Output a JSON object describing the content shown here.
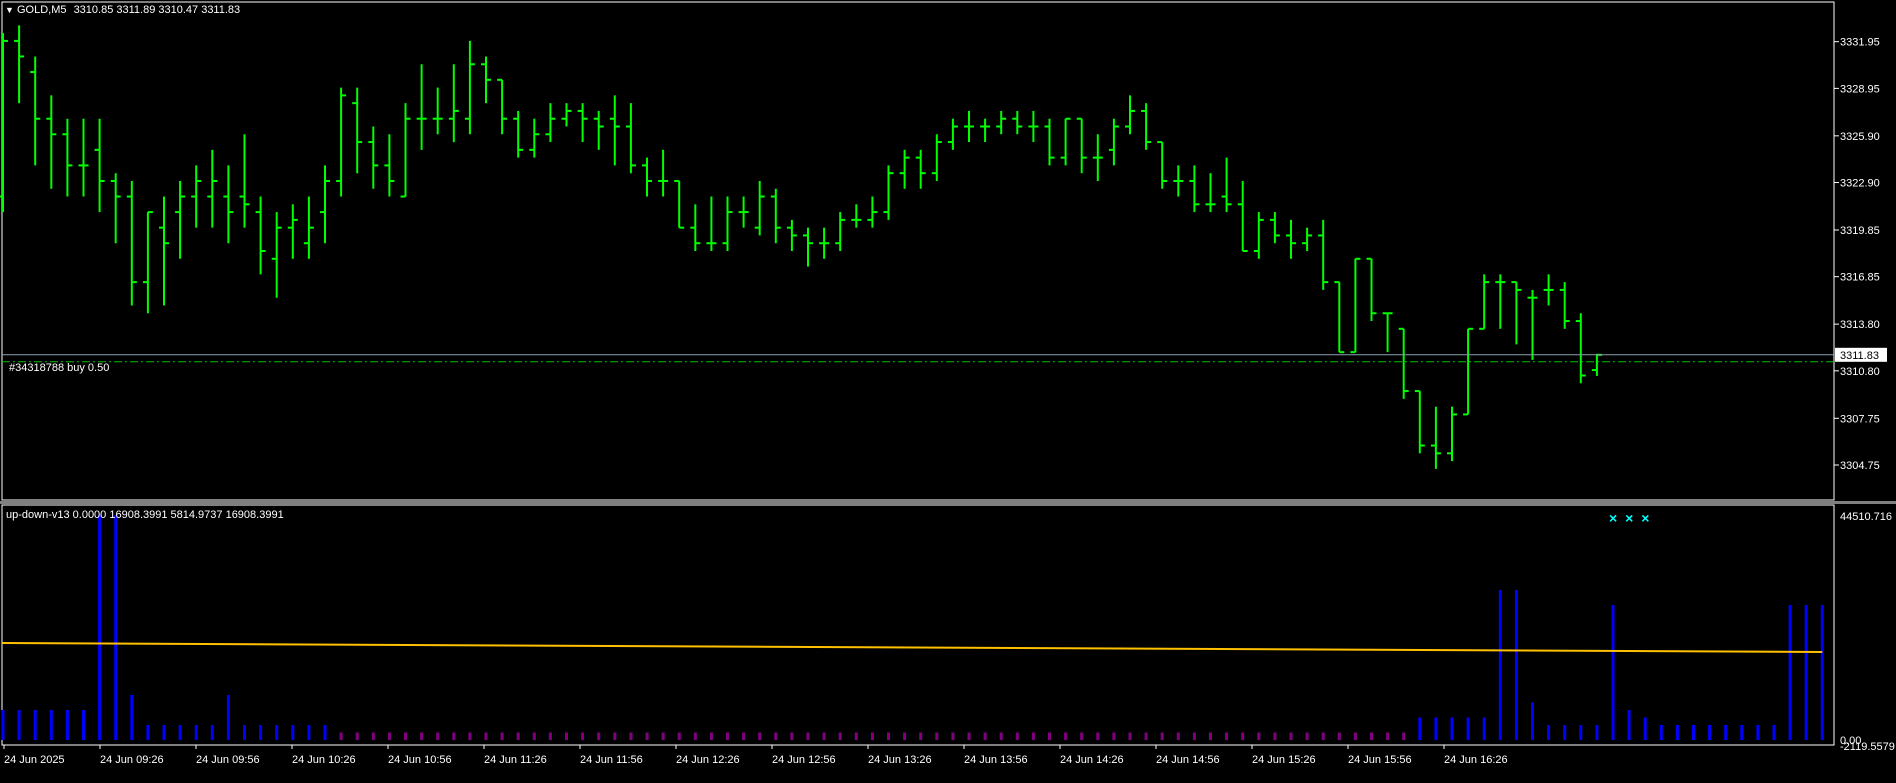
{
  "chart": {
    "symbol_label": "GOLD,M5",
    "ohlc_label": "3310.85 3311.89 3310.47 3311.83",
    "menu_glyph": "▼",
    "current_price_label": "3311.83",
    "order_line_label": "#34318788 buy 0.50",
    "colors": {
      "background": "#000000",
      "bars": "#00ff00",
      "grid": "#ffffff",
      "order_line": "#00c000",
      "price_line": "#8aa0b0",
      "hist": "#0000ff",
      "ma": "#ffc000",
      "marker": "#00ffff",
      "tiny": "#800080"
    }
  },
  "price_axis": {
    "ticks": [
      "3331.95",
      "3328.95",
      "3325.90",
      "3322.90",
      "3319.85",
      "3316.85",
      "3313.80",
      "3310.80",
      "3307.75",
      "3304.75"
    ]
  },
  "indicator": {
    "label": "up-down-v13 0.0000 16908.3991 5814.9737 16908.3991",
    "top_label": "44510.716",
    "bottom_label": "-2119.5579",
    "zero_label": "0.00",
    "markers": [
      "×",
      "×",
      "×"
    ]
  },
  "time_axis": {
    "labels": [
      "24 Jun 2025",
      "24 Jun 09:26",
      "24 Jun 09:56",
      "24 Jun 10:26",
      "24 Jun 10:56",
      "24 Jun 11:26",
      "24 Jun 11:56",
      "24 Jun 12:26",
      "24 Jun 12:56",
      "24 Jun 13:26",
      "24 Jun 13:56",
      "24 Jun 14:26",
      "24 Jun 14:56",
      "24 Jun 15:26",
      "24 Jun 15:56",
      "24 Jun 16:26"
    ]
  },
  "chart_data": {
    "type": "ohlc",
    "yrange": [
      3302.5,
      3334.5
    ],
    "bars": [
      [
        3322.0,
        3332.5,
        3321.0,
        3332.0
      ],
      [
        3332.0,
        3333.0,
        3328.0,
        3331.0
      ],
      [
        3330.0,
        3331.0,
        3324.0,
        3327.0
      ],
      [
        3327.0,
        3328.5,
        3322.5,
        3326.0
      ],
      [
        3326.0,
        3327.0,
        3322.0,
        3324.0
      ],
      [
        3324.0,
        3327.0,
        3322.0,
        3324.0
      ],
      [
        3325.0,
        3327.0,
        3321.0,
        3323.0
      ],
      [
        3323.0,
        3323.5,
        3319.0,
        3322.0
      ],
      [
        3322.0,
        3323.0,
        3315.0,
        3316.5
      ],
      [
        3316.5,
        3321.0,
        3314.5,
        3321.0
      ],
      [
        3320.0,
        3322.0,
        3315.0,
        3319.0
      ],
      [
        3321.0,
        3323.0,
        3318.0,
        3322.0
      ],
      [
        3322.0,
        3324.0,
        3320.0,
        3323.0
      ],
      [
        3322.0,
        3325.0,
        3320.0,
        3323.0
      ],
      [
        3322.0,
        3324.0,
        3319.0,
        3321.0
      ],
      [
        3322.0,
        3326.0,
        3320.0,
        3321.5
      ],
      [
        3321.0,
        3322.0,
        3317.0,
        3318.5
      ],
      [
        3318.0,
        3321.0,
        3315.5,
        3320.0
      ],
      [
        3320.0,
        3321.5,
        3318.0,
        3320.5
      ],
      [
        3319.0,
        3322.0,
        3318.0,
        3320.0
      ],
      [
        3321.0,
        3324.0,
        3319.0,
        3323.0
      ],
      [
        3323.0,
        3329.0,
        3322.0,
        3328.5
      ],
      [
        3328.0,
        3329.0,
        3323.5,
        3325.5
      ],
      [
        3325.5,
        3326.5,
        3322.5,
        3324.0
      ],
      [
        3324.0,
        3326.0,
        3322.0,
        3323.0
      ],
      [
        3322.0,
        3328.0,
        3322.0,
        3327.0
      ],
      [
        3327.0,
        3330.5,
        3325.0,
        3327.0
      ],
      [
        3327.0,
        3329.0,
        3326.0,
        3327.0
      ],
      [
        3327.0,
        3330.5,
        3325.5,
        3327.5
      ],
      [
        3327.0,
        3332.0,
        3326.0,
        3330.5
      ],
      [
        3330.5,
        3331.0,
        3328.0,
        3329.5
      ],
      [
        3329.5,
        3329.5,
        3326.0,
        3327.0
      ],
      [
        3327.0,
        3327.5,
        3324.5,
        3325.0
      ],
      [
        3325.0,
        3327.0,
        3324.5,
        3326.0
      ],
      [
        3326.0,
        3328.0,
        3325.5,
        3327.0
      ],
      [
        3327.0,
        3328.0,
        3326.5,
        3327.5
      ],
      [
        3327.5,
        3328.0,
        3325.5,
        3327.0
      ],
      [
        3327.0,
        3327.5,
        3325.0,
        3326.5
      ],
      [
        3327.0,
        3328.5,
        3324.0,
        3326.5
      ],
      [
        3326.5,
        3328.0,
        3323.5,
        3324.0
      ],
      [
        3324.0,
        3324.5,
        3322.0,
        3323.0
      ],
      [
        3323.0,
        3325.0,
        3322.0,
        3323.0
      ],
      [
        3323.0,
        3323.0,
        3320.0,
        3320.0
      ],
      [
        3320.0,
        3321.5,
        3318.5,
        3319.0
      ],
      [
        3319.0,
        3322.0,
        3318.5,
        3319.0
      ],
      [
        3319.0,
        3322.0,
        3318.5,
        3321.0
      ],
      [
        3321.0,
        3322.0,
        3320.0,
        3321.0
      ],
      [
        3320.0,
        3323.0,
        3319.5,
        3322.0
      ],
      [
        3322.0,
        3322.5,
        3319.0,
        3320.0
      ],
      [
        3320.0,
        3320.5,
        3318.5,
        3319.5
      ],
      [
        3319.5,
        3320.0,
        3317.5,
        3319.0
      ],
      [
        3319.0,
        3320.0,
        3318.0,
        3319.0
      ],
      [
        3319.0,
        3321.0,
        3318.5,
        3320.5
      ],
      [
        3320.5,
        3321.5,
        3320.0,
        3320.5
      ],
      [
        3320.5,
        3322.0,
        3320.0,
        3321.0
      ],
      [
        3321.0,
        3324.0,
        3320.5,
        3323.5
      ],
      [
        3323.5,
        3325.0,
        3322.5,
        3324.5
      ],
      [
        3324.5,
        3325.0,
        3322.5,
        3323.5
      ],
      [
        3323.5,
        3326.0,
        3323.0,
        3325.5
      ],
      [
        3325.5,
        3327.0,
        3325.0,
        3326.5
      ],
      [
        3326.5,
        3327.5,
        3325.5,
        3326.5
      ],
      [
        3326.5,
        3327.0,
        3325.5,
        3326.5
      ],
      [
        3326.5,
        3327.5,
        3326.0,
        3327.0
      ],
      [
        3327.0,
        3327.5,
        3326.0,
        3326.5
      ],
      [
        3326.5,
        3327.5,
        3325.5,
        3326.5
      ],
      [
        3326.5,
        3327.0,
        3324.0,
        3324.5
      ],
      [
        3324.5,
        3327.0,
        3324.0,
        3327.0
      ],
      [
        3327.0,
        3327.0,
        3323.5,
        3324.5
      ],
      [
        3324.5,
        3326.0,
        3323.0,
        3324.5
      ],
      [
        3325.0,
        3327.0,
        3324.0,
        3326.5
      ],
      [
        3326.5,
        3328.5,
        3326.0,
        3327.5
      ],
      [
        3327.5,
        3328.0,
        3325.0,
        3325.5
      ],
      [
        3325.5,
        3325.5,
        3322.5,
        3323.0
      ],
      [
        3323.0,
        3324.0,
        3322.0,
        3323.0
      ],
      [
        3323.0,
        3324.0,
        3321.0,
        3321.5
      ],
      [
        3321.5,
        3323.5,
        3321.0,
        3321.5
      ],
      [
        3322.0,
        3324.5,
        3321.0,
        3321.5
      ],
      [
        3321.5,
        3323.0,
        3318.5,
        3318.5
      ],
      [
        3318.5,
        3321.0,
        3318.0,
        3320.5
      ],
      [
        3320.5,
        3321.0,
        3319.0,
        3319.5
      ],
      [
        3319.5,
        3320.5,
        3318.0,
        3319.0
      ],
      [
        3319.0,
        3320.0,
        3318.5,
        3319.5
      ],
      [
        3319.5,
        3320.5,
        3316.0,
        3316.5
      ],
      [
        3316.5,
        3316.5,
        3312.0,
        3312.0
      ],
      [
        3312.0,
        3318.0,
        3312.0,
        3318.0
      ],
      [
        3318.0,
        3318.0,
        3314.0,
        3314.5
      ],
      [
        3314.5,
        3314.5,
        3312.0,
        3314.5
      ],
      [
        3313.5,
        3313.5,
        3309.0,
        3309.5
      ],
      [
        3309.5,
        3309.5,
        3305.5,
        3306.0
      ],
      [
        3306.0,
        3308.5,
        3304.5,
        3305.5
      ],
      [
        3305.5,
        3308.5,
        3305.0,
        3308.0
      ],
      [
        3308.0,
        3313.5,
        3308.0,
        3313.5
      ],
      [
        3313.5,
        3317.0,
        3313.5,
        3316.5
      ],
      [
        3316.5,
        3317.0,
        3313.5,
        3316.5
      ],
      [
        3316.5,
        3316.5,
        3312.5,
        3316.0
      ],
      [
        3315.5,
        3316.0,
        3311.5,
        3315.5
      ],
      [
        3316.0,
        3317.0,
        3315.0,
        3316.0
      ],
      [
        3316.0,
        3316.5,
        3313.5,
        3314.0
      ],
      [
        3314.0,
        3314.5,
        3310.0,
        3310.5
      ],
      [
        3310.85,
        3311.89,
        3310.47,
        3311.83
      ]
    ],
    "hist": [
      40,
      40,
      40,
      40,
      40,
      40,
      300,
      300,
      60,
      20,
      20,
      20,
      20,
      20,
      60,
      20,
      20,
      20,
      20,
      20,
      20,
      10,
      10,
      10,
      10,
      10,
      10,
      10,
      10,
      10,
      10,
      10,
      10,
      10,
      10,
      10,
      10,
      10,
      10,
      10,
      10,
      10,
      10,
      10,
      10,
      10,
      10,
      10,
      10,
      10,
      10,
      10,
      10,
      10,
      10,
      10,
      10,
      10,
      10,
      10,
      10,
      10,
      10,
      10,
      10,
      10,
      10,
      10,
      10,
      10,
      10,
      10,
      10,
      10,
      10,
      10,
      10,
      10,
      10,
      10,
      10,
      10,
      10,
      10,
      10,
      10,
      10,
      10,
      30,
      30,
      30,
      30,
      30,
      200,
      200,
      50,
      20,
      20,
      20,
      20,
      180,
      40,
      30,
      20,
      20,
      20,
      20,
      20,
      20,
      20,
      20,
      180,
      180,
      180
    ],
    "ma_endpoints": [
      7800,
      7300
    ]
  }
}
